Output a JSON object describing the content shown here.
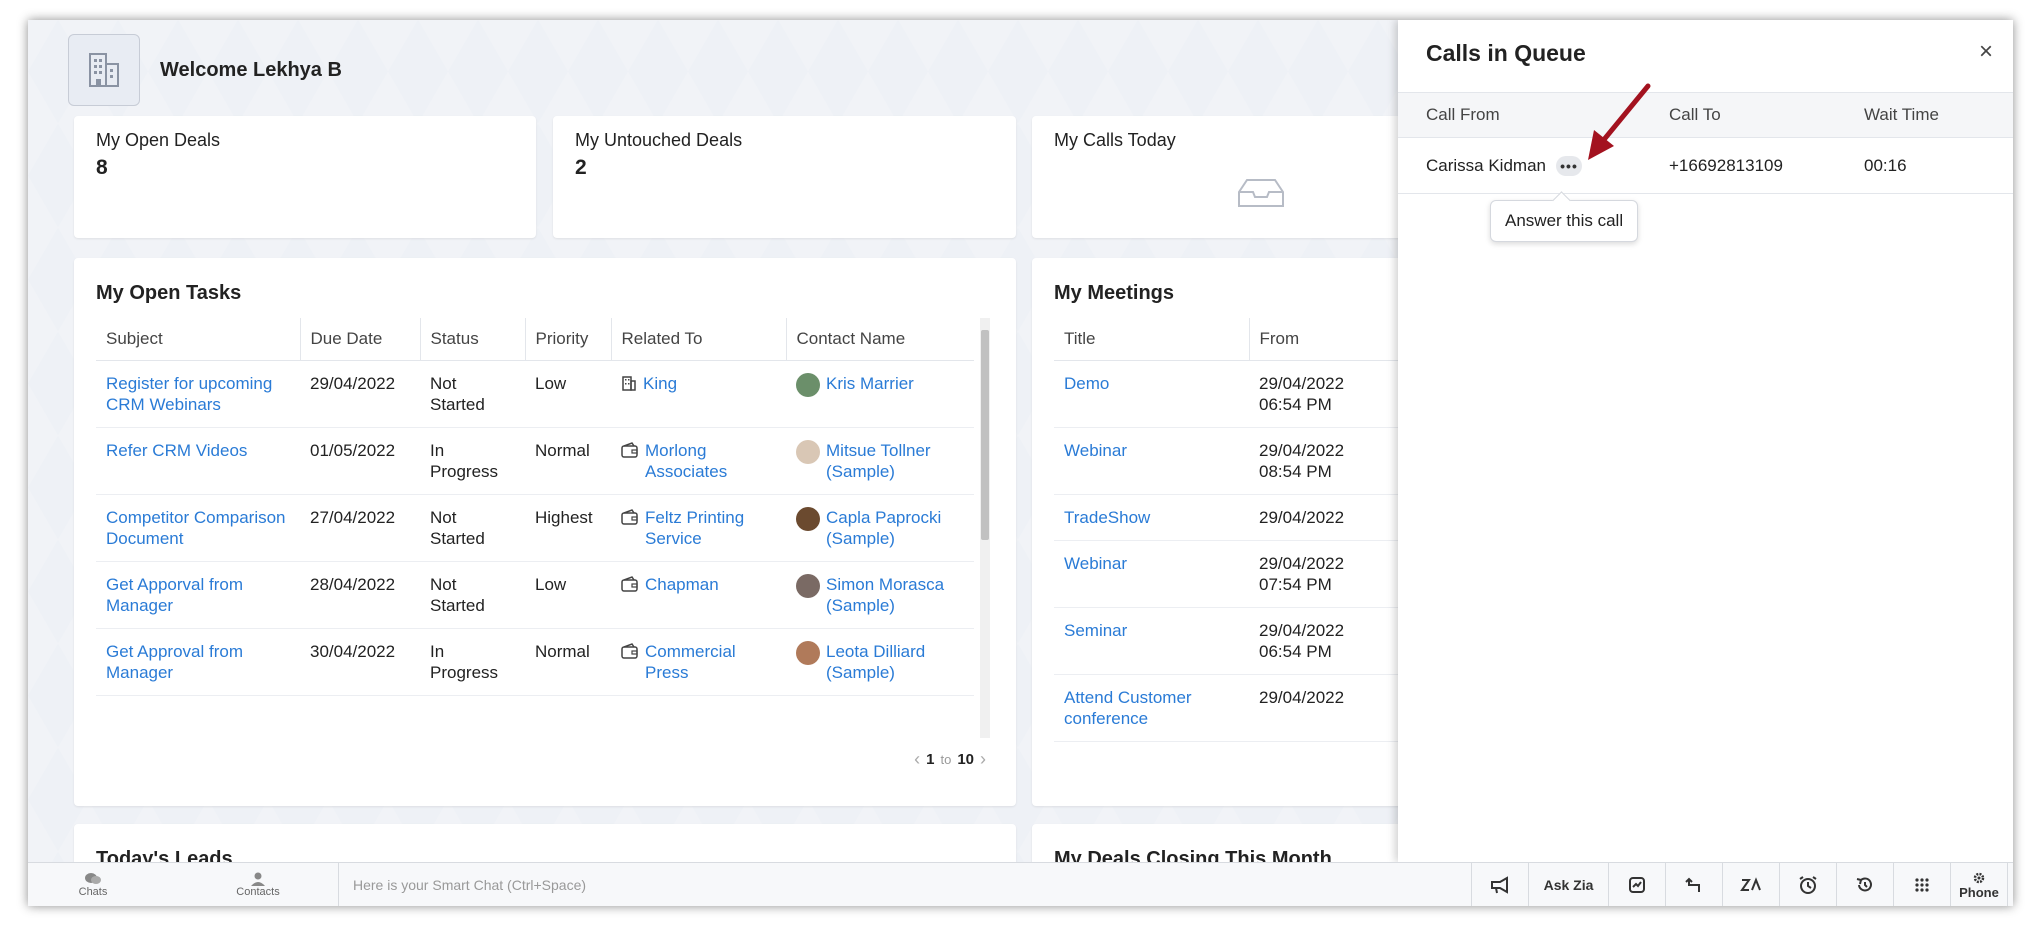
{
  "welcome": {
    "text": "Welcome Lekhya B"
  },
  "kpis": [
    {
      "label": "My Open Deals",
      "value": "8"
    },
    {
      "label": "My Untouched Deals",
      "value": "2"
    },
    {
      "label": "My Calls Today",
      "value": ""
    }
  ],
  "tasks": {
    "title": "My Open Tasks",
    "columns": [
      "Subject",
      "Due Date",
      "Status",
      "Priority",
      "Related To",
      "Contact Name"
    ],
    "rows": [
      {
        "subject": "Register for upcoming CRM Webinars",
        "due": "29/04/2022",
        "status": "Not Started",
        "priority": "Low",
        "related": "King",
        "related_icon": "building-icon",
        "contact": "Kris Marrier",
        "avatar": "#6b8f6a"
      },
      {
        "subject": "Refer CRM Videos",
        "due": "01/05/2022",
        "status": "In Progress",
        "priority": "Normal",
        "related": "Morlong Associates",
        "related_icon": "wallet-icon",
        "contact": "Mitsue Tollner (Sample)",
        "avatar": "#d9c7b5"
      },
      {
        "subject": "Competitor Comparison Document",
        "due": "27/04/2022",
        "status": "Not Started",
        "priority": "Highest",
        "related": "Feltz Printing Service",
        "related_icon": "wallet-icon",
        "contact": "Capla Paprocki (Sample)",
        "avatar": "#6b4a2f"
      },
      {
        "subject": "Get Apporval from Manager",
        "due": "28/04/2022",
        "status": "Not Started",
        "priority": "Low",
        "related": "Chapman",
        "related_icon": "wallet-icon",
        "contact": "Simon Morasca (Sample)",
        "avatar": "#7a6a64"
      },
      {
        "subject": "Get Approval from Manager",
        "due": "30/04/2022",
        "status": "In Progress",
        "priority": "Normal",
        "related": "Commercial Press",
        "related_icon": "wallet-icon",
        "contact": "Leota Dilliard (Sample)",
        "avatar": "#b07a5a"
      }
    ],
    "pager": {
      "from": "1",
      "sep": "to",
      "to": "10"
    }
  },
  "meetings": {
    "title": "My Meetings",
    "columns": [
      "Title",
      "From"
    ],
    "rows": [
      {
        "title": "Demo",
        "from1": "29/04/2022",
        "from2": "06:54 PM"
      },
      {
        "title": "Webinar",
        "from1": "29/04/2022",
        "from2": "08:54 PM"
      },
      {
        "title": "TradeShow",
        "from1": "29/04/2022",
        "from2": ""
      },
      {
        "title": "Webinar",
        "from1": "29/04/2022",
        "from2": "07:54 PM"
      },
      {
        "title": "Seminar",
        "from1": "29/04/2022",
        "from2": "06:54 PM"
      },
      {
        "title": "Attend Customer conference",
        "from1": "29/04/2022",
        "from2": ""
      }
    ]
  },
  "bottom_cards": {
    "left": "Today's Leads",
    "right": "My Deals Closing This Month"
  },
  "queue": {
    "title": "Calls in Queue",
    "close": "×",
    "columns": {
      "from": "Call From",
      "to": "Call To",
      "wait": "Wait Time"
    },
    "row": {
      "from": "Carissa Kidman",
      "to": "+16692813109",
      "wait": "00:16"
    },
    "more": "•••",
    "tooltip": "Answer this call"
  },
  "bottombar": {
    "chats": "Chats",
    "contacts": "Contacts",
    "smart_chat": "Here is your Smart Chat (Ctrl+Space)",
    "ask_zia": "Ask Zia",
    "phone": "Phone"
  },
  "colors": {
    "link": "#2a7bd6",
    "arrow": "#a3121f"
  }
}
